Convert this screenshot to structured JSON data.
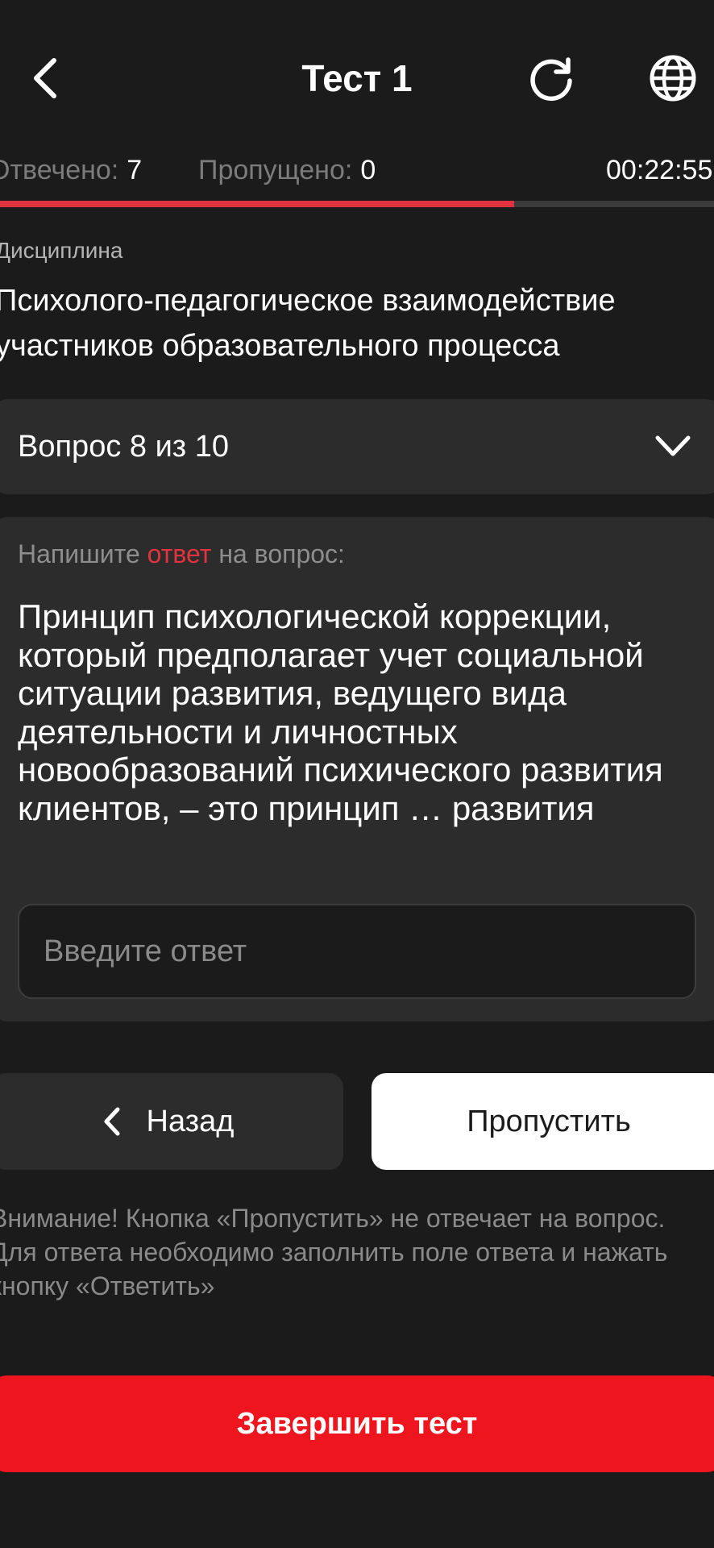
{
  "header": {
    "title": "Тест 1"
  },
  "stats": {
    "answered_label": "Отвечено:",
    "answered_value": "7",
    "skipped_label": "Пропущено:",
    "skipped_value": "0",
    "timer": "00:22:55"
  },
  "progress": {
    "fraction": 0.72
  },
  "discipline": {
    "label": "Дисциплина",
    "name": "Психолого-педагогическое взаимодействие участников образовательного процесса"
  },
  "question_selector": {
    "label": "Вопрос 8 из 10"
  },
  "question": {
    "instruction_prefix": "Напишите",
    "instruction_accent": "ответ",
    "instruction_suffix": "на вопрос:",
    "text": "Принцип психологической коррекции, который предполагает учет социальной ситуации развития, ведущего вида деятельности и личностных новообразований психического развития клиентов, – это принцип … развития",
    "answer_value": "",
    "answer_placeholder": "Введите ответ"
  },
  "buttons": {
    "back_label": "Назад",
    "skip_label": "Пропустить",
    "finish_label": "Завершить тест"
  },
  "notice": "Внимание! Кнопка «Пропустить» не отвечает на вопрос. Для ответа необходимо заполнить поле ответа и нажать кнопку «Ответить»",
  "colors": {
    "background": "#1b1b1b",
    "card": "#2c2c2c",
    "accent_red": "#e2333e",
    "finish_red": "#ee151f",
    "progress_track": "#3b3b3b"
  },
  "icons": {
    "back": "chevron-left-icon",
    "refresh": "refresh-icon",
    "language": "globe-icon",
    "selector": "chevron-down-icon"
  }
}
